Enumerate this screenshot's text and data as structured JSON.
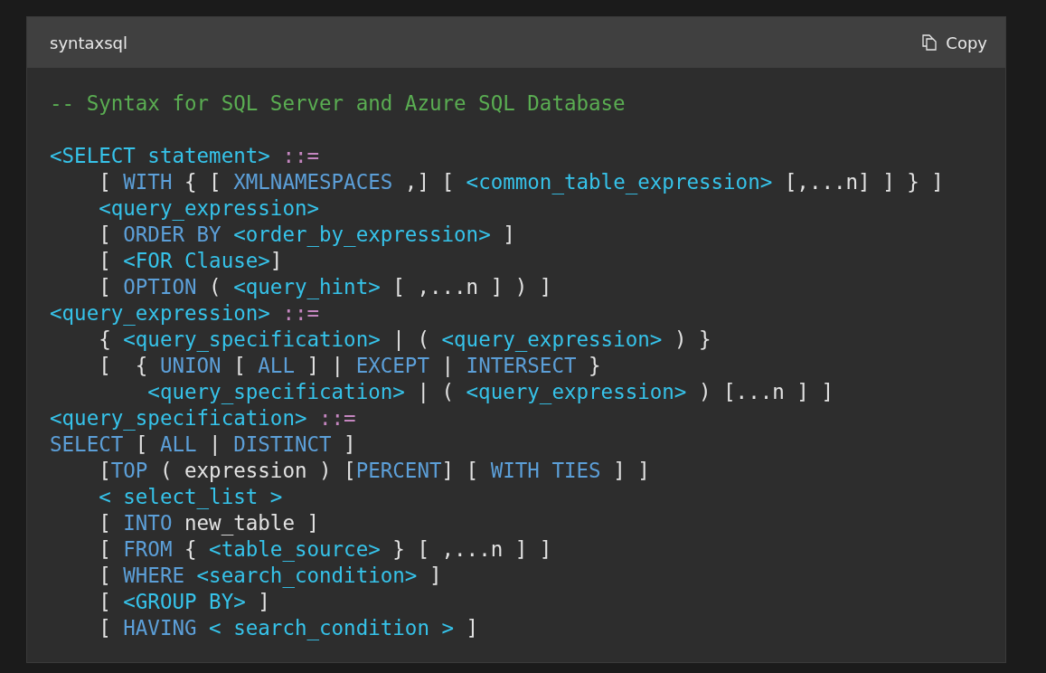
{
  "header": {
    "language": "syntaxsql",
    "copy_label": "Copy"
  },
  "code": {
    "blocks": [
      {
        "lines": [
          [
            {
              "kind": "comment",
              "text": "-- Syntax for SQL Server and Azure SQL Database"
            }
          ]
        ]
      },
      {
        "lines": [
          [
            {
              "kind": "identifier",
              "text": "<SELECT statement>"
            },
            {
              "kind": "operator",
              "text": " ::="
            }
          ],
          [
            {
              "kind": "plain",
              "text": "    [ "
            },
            {
              "kind": "keyword",
              "text": "WITH"
            },
            {
              "kind": "plain",
              "text": " { [ "
            },
            {
              "kind": "keyword",
              "text": "XMLNAMESPACES"
            },
            {
              "kind": "plain",
              "text": " ,] [ "
            },
            {
              "kind": "identifier",
              "text": "<common_table_expression>"
            },
            {
              "kind": "plain",
              "text": " [,...n] ] } ]"
            }
          ],
          [
            {
              "kind": "identifier",
              "text": "    <query_expression>"
            }
          ],
          [
            {
              "kind": "plain",
              "text": "    [ "
            },
            {
              "kind": "keyword",
              "text": "ORDER BY"
            },
            {
              "kind": "identifier",
              "text": " <order_by_expression>"
            },
            {
              "kind": "plain",
              "text": " ]"
            }
          ],
          [
            {
              "kind": "plain",
              "text": "    [ "
            },
            {
              "kind": "identifier",
              "text": "<FOR Clause>"
            },
            {
              "kind": "plain",
              "text": "]"
            }
          ],
          [
            {
              "kind": "plain",
              "text": "    [ "
            },
            {
              "kind": "keyword",
              "text": "OPTION"
            },
            {
              "kind": "plain",
              "text": " ( "
            },
            {
              "kind": "identifier",
              "text": "<query_hint>"
            },
            {
              "kind": "plain",
              "text": " [ ,...n ] ) ]"
            }
          ],
          [
            {
              "kind": "identifier",
              "text": "<query_expression>"
            },
            {
              "kind": "operator",
              "text": " ::="
            }
          ],
          [
            {
              "kind": "plain",
              "text": "    { "
            },
            {
              "kind": "identifier",
              "text": "<query_specification>"
            },
            {
              "kind": "plain",
              "text": " | ( "
            },
            {
              "kind": "identifier",
              "text": "<query_expression>"
            },
            {
              "kind": "plain",
              "text": " ) }"
            }
          ],
          [
            {
              "kind": "plain",
              "text": "    [  { "
            },
            {
              "kind": "keyword",
              "text": "UNION"
            },
            {
              "kind": "plain",
              "text": " [ "
            },
            {
              "kind": "keyword",
              "text": "ALL"
            },
            {
              "kind": "plain",
              "text": " ] | "
            },
            {
              "kind": "keyword",
              "text": "EXCEPT"
            },
            {
              "kind": "plain",
              "text": " | "
            },
            {
              "kind": "keyword",
              "text": "INTERSECT"
            },
            {
              "kind": "plain",
              "text": " }"
            }
          ],
          [
            {
              "kind": "identifier",
              "text": "        <query_specification>"
            },
            {
              "kind": "plain",
              "text": " | ( "
            },
            {
              "kind": "identifier",
              "text": "<query_expression>"
            },
            {
              "kind": "plain",
              "text": " ) [...n ] ]"
            }
          ],
          [
            {
              "kind": "identifier",
              "text": "<query_specification>"
            },
            {
              "kind": "operator",
              "text": " ::="
            }
          ],
          [
            {
              "kind": "keyword",
              "text": "SELECT"
            },
            {
              "kind": "plain",
              "text": " [ "
            },
            {
              "kind": "keyword",
              "text": "ALL"
            },
            {
              "kind": "plain",
              "text": " | "
            },
            {
              "kind": "keyword",
              "text": "DISTINCT"
            },
            {
              "kind": "plain",
              "text": " ]"
            }
          ],
          [
            {
              "kind": "plain",
              "text": "    ["
            },
            {
              "kind": "keyword",
              "text": "TOP"
            },
            {
              "kind": "plain",
              "text": " ( expression ) ["
            },
            {
              "kind": "keyword",
              "text": "PERCENT"
            },
            {
              "kind": "plain",
              "text": "] [ "
            },
            {
              "kind": "keyword",
              "text": "WITH TIES"
            },
            {
              "kind": "plain",
              "text": " ] ]"
            }
          ],
          [
            {
              "kind": "identifier",
              "text": "    < select_list >"
            }
          ],
          [
            {
              "kind": "plain",
              "text": "    [ "
            },
            {
              "kind": "keyword",
              "text": "INTO"
            },
            {
              "kind": "plain",
              "text": " new_table ]"
            }
          ],
          [
            {
              "kind": "plain",
              "text": "    [ "
            },
            {
              "kind": "keyword",
              "text": "FROM"
            },
            {
              "kind": "plain",
              "text": " { "
            },
            {
              "kind": "identifier",
              "text": "<table_source>"
            },
            {
              "kind": "plain",
              "text": " } [ ,...n ] ]"
            }
          ],
          [
            {
              "kind": "plain",
              "text": "    [ "
            },
            {
              "kind": "keyword",
              "text": "WHERE"
            },
            {
              "kind": "identifier",
              "text": " <search_condition>"
            },
            {
              "kind": "plain",
              "text": " ]"
            }
          ],
          [
            {
              "kind": "plain",
              "text": "    [ "
            },
            {
              "kind": "identifier",
              "text": "<GROUP BY>"
            },
            {
              "kind": "plain",
              "text": " ]"
            }
          ],
          [
            {
              "kind": "plain",
              "text": "    [ "
            },
            {
              "kind": "keyword",
              "text": "HAVING"
            },
            {
              "kind": "identifier",
              "text": " < search_condition >"
            },
            {
              "kind": "plain",
              "text": " ]"
            }
          ]
        ]
      }
    ]
  }
}
